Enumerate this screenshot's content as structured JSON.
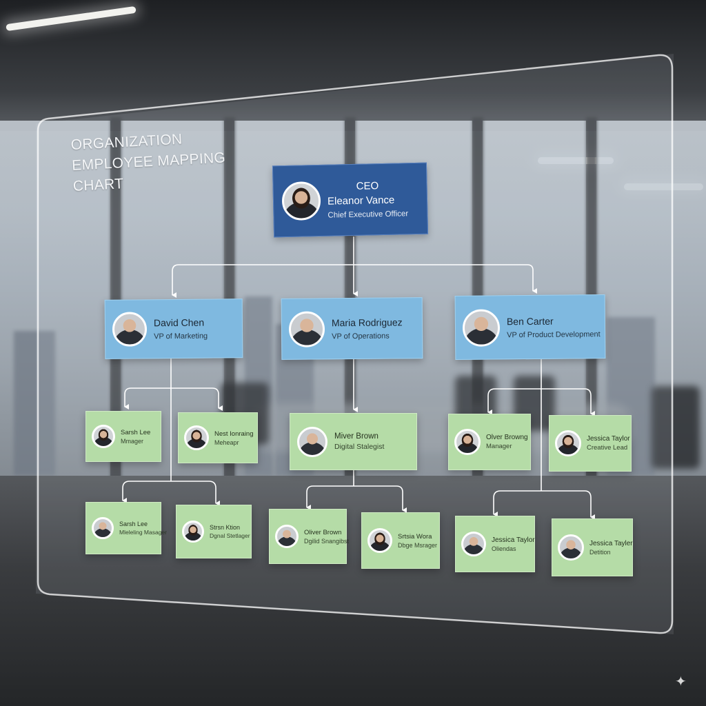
{
  "chart": {
    "title": "ORGANIZATION EMPLOYEE MAPPING CHART"
  },
  "ceo": {
    "level": "CEO",
    "name": "Eleanor Vance",
    "role": "Chief Executive Officer"
  },
  "vps": [
    {
      "name": "David Chen",
      "role": "VP of Marketing"
    },
    {
      "name": "Maria Rodriguez",
      "role": "VP of Operations"
    },
    {
      "name": "Ben Carter",
      "role": "VP of Product Development"
    }
  ],
  "tier3": [
    {
      "name": "Sarsh Lee",
      "role": "Mmager"
    },
    {
      "name": "Nest Ionraing",
      "role": "Meheapr"
    },
    {
      "name": "Miver Brown",
      "role": "Digital Stalegist"
    },
    {
      "name": "Olver Browng",
      "role": "Manager"
    },
    {
      "name": "Jessica Taylor",
      "role": "Creative Lead"
    }
  ],
  "tier4": [
    {
      "name": "Sarsh Lee",
      "role": "Mleleling Masager"
    },
    {
      "name": "Strsn Ktion",
      "role": "Dgnal Stetlager"
    },
    {
      "name": "Oliver Brown",
      "role": "Dgilid Snangibst"
    },
    {
      "name": "Srtsia Wora",
      "role": "Dbge Msrager"
    },
    {
      "name": "Jessica Taylor",
      "role": "Oliendas"
    },
    {
      "name": "Jessica Tayler",
      "role": "Detition"
    }
  ],
  "colors": {
    "ceo_card": "#2f5a99",
    "vp_card": "#7fb9e0",
    "staff_card": "#b5dca7",
    "connector": "#ffffff"
  },
  "icons": {
    "watermark": "sparkle-icon"
  }
}
